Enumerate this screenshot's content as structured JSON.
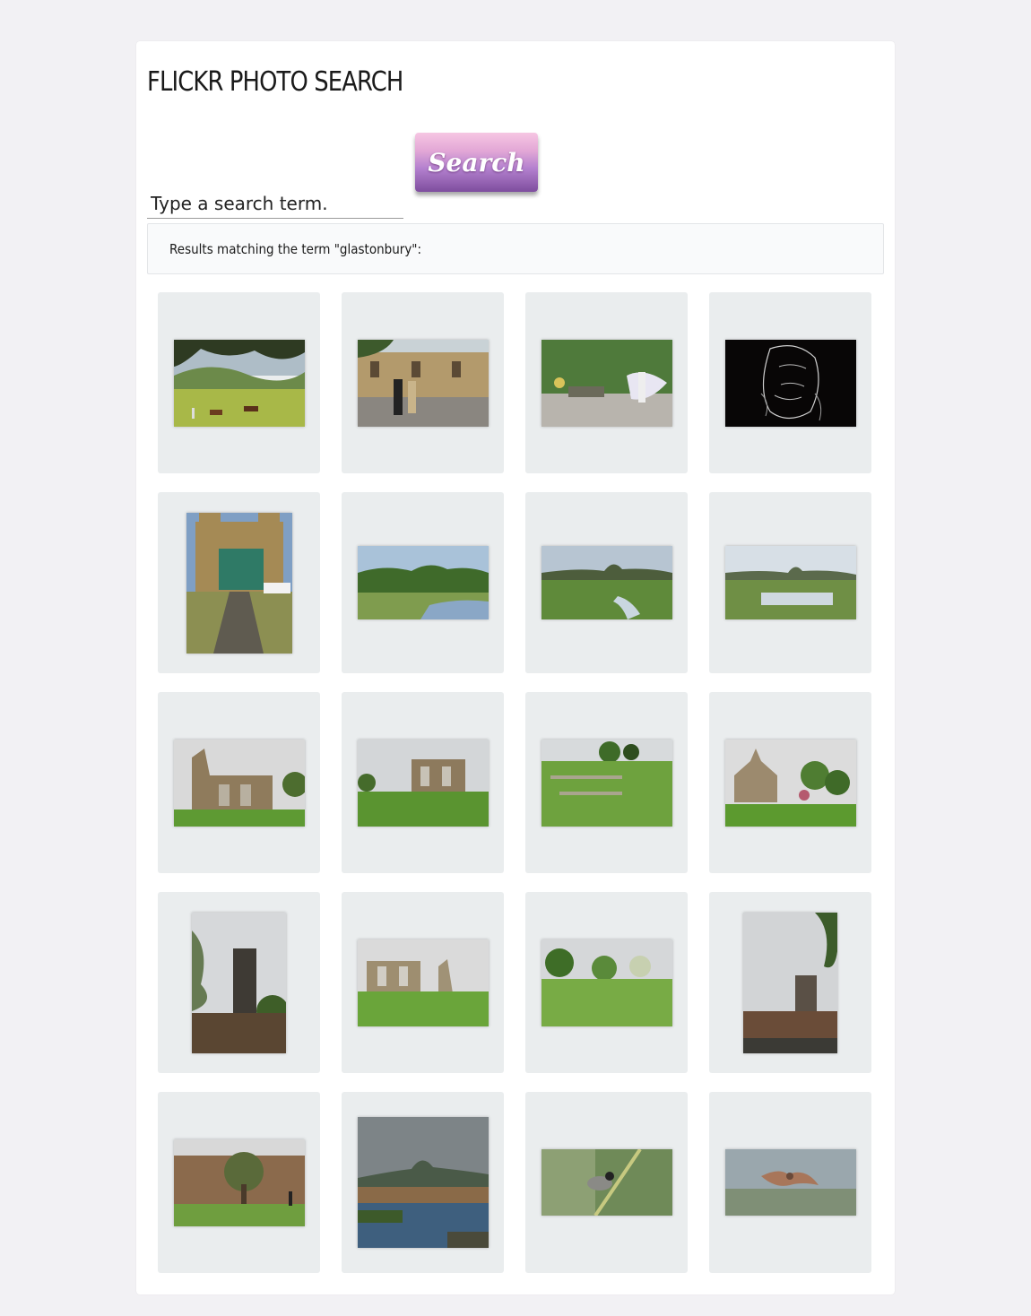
{
  "page": {
    "title": "FLICKR PHOTO SEARCH"
  },
  "search": {
    "placeholder": "Type a search term.",
    "value": "",
    "button_label": "Search"
  },
  "results": {
    "message": "Results matching the term \"glastonbury\":"
  },
  "photos": [
    {
      "name": "photo-horses-meadow",
      "orientation": "landscape"
    },
    {
      "name": "photo-church-costumed-figures",
      "orientation": "landscape"
    },
    {
      "name": "photo-street-performers",
      "orientation": "landscape"
    },
    {
      "name": "photo-dark-line-art-face",
      "orientation": "landscape"
    },
    {
      "name": "photo-cathedral-facade",
      "orientation": "portrait"
    },
    {
      "name": "photo-wetland-tor-1",
      "orientation": "landscape"
    },
    {
      "name": "photo-wetland-tor-2",
      "orientation": "landscape"
    },
    {
      "name": "photo-wetland-tor-3",
      "orientation": "landscape"
    },
    {
      "name": "photo-abbey-ruins-1",
      "orientation": "landscape"
    },
    {
      "name": "photo-abbey-ruins-2",
      "orientation": "landscape"
    },
    {
      "name": "photo-abbey-grounds",
      "orientation": "landscape"
    },
    {
      "name": "photo-abbots-kitchen",
      "orientation": "landscape"
    },
    {
      "name": "photo-church-tower-1",
      "orientation": "portrait"
    },
    {
      "name": "photo-abbey-ruins-3",
      "orientation": "landscape"
    },
    {
      "name": "photo-abbey-lawn",
      "orientation": "landscape"
    },
    {
      "name": "photo-church-tower-2",
      "orientation": "portrait"
    },
    {
      "name": "photo-tree-wall-garden",
      "orientation": "landscape"
    },
    {
      "name": "photo-tor-lake",
      "orientation": "square"
    },
    {
      "name": "photo-bird-on-branch",
      "orientation": "landscape"
    },
    {
      "name": "photo-bird-in-flight",
      "orientation": "landscape"
    }
  ]
}
